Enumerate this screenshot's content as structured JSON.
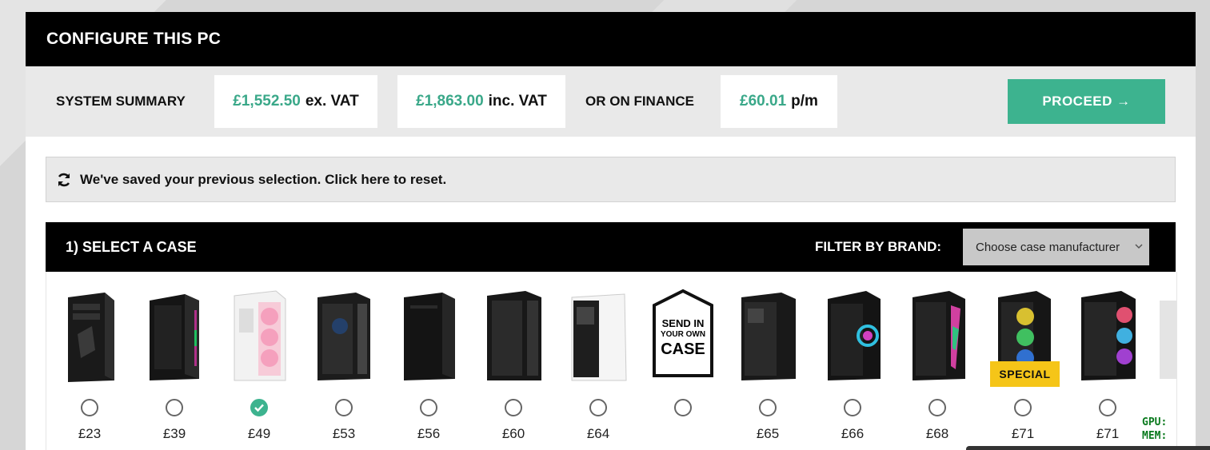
{
  "header": {
    "title": "CONFIGURE THIS PC"
  },
  "summary": {
    "label": "SYSTEM SUMMARY",
    "ex_vat_amount": "£1,552.50",
    "ex_vat_suffix": "ex. VAT",
    "inc_vat_amount": "£1,863.00",
    "inc_vat_suffix": "inc. VAT",
    "finance_label": "OR ON FINANCE",
    "finance_amount": "£60.01",
    "finance_suffix": "p/m",
    "proceed_label": "PROCEED →"
  },
  "notice": {
    "text": "We've saved your previous selection. Click here to reset.",
    "icon": "refresh-icon"
  },
  "case_section": {
    "title": "1) SELECT A CASE",
    "filter_label": "FILTER BY BRAND:",
    "filter_value": "Choose case manufacturer",
    "badge": "SPECIAL",
    "send_own_case": [
      "SEND IN",
      "YOUR OWN",
      "CASE"
    ],
    "cases": [
      {
        "price": "£23",
        "selected": false
      },
      {
        "price": "£39",
        "selected": false
      },
      {
        "price": "£49",
        "selected": true
      },
      {
        "price": "£53",
        "selected": false
      },
      {
        "price": "£56",
        "selected": false
      },
      {
        "price": "£60",
        "selected": false
      },
      {
        "price": "£64",
        "selected": false
      },
      {
        "price": "",
        "selected": false
      },
      {
        "price": "£65",
        "selected": false
      },
      {
        "price": "£66",
        "selected": false
      },
      {
        "price": "£68",
        "selected": false
      },
      {
        "price": "£71",
        "selected": false
      },
      {
        "price": "£71",
        "selected": false
      }
    ]
  },
  "overlay": {
    "line1": "GPU:",
    "line2": "MEM:"
  },
  "colors": {
    "accent": "#3db38f",
    "price_green": "#3aa889",
    "badge": "#f5c518"
  }
}
